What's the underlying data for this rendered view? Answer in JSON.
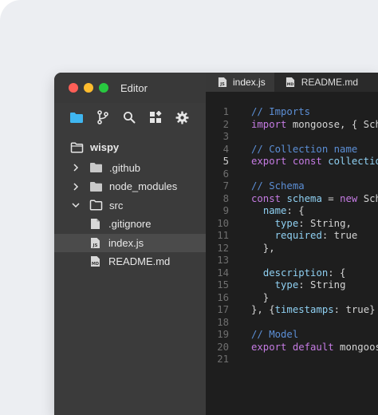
{
  "window": {
    "title": "Editor"
  },
  "activity_bar": [
    {
      "name": "explorer-icon",
      "active": true
    },
    {
      "name": "source-control-icon",
      "active": false
    },
    {
      "name": "search-icon",
      "active": false
    },
    {
      "name": "extensions-icon",
      "active": false
    },
    {
      "name": "settings-icon",
      "active": false
    }
  ],
  "explorer": {
    "root": "wispy",
    "items": [
      {
        "label": ".github",
        "type": "folder",
        "expanded": false
      },
      {
        "label": "node_modules",
        "type": "folder",
        "expanded": false
      },
      {
        "label": "src",
        "type": "folder",
        "expanded": true
      },
      {
        "label": ".gitignore",
        "type": "file",
        "badge": ""
      },
      {
        "label": "index.js",
        "type": "file",
        "badge": "JS",
        "selected": true
      },
      {
        "label": "README.md",
        "type": "file",
        "badge": "MD"
      }
    ]
  },
  "tabs": [
    {
      "label": "index.js",
      "badge": "JS",
      "active": true
    },
    {
      "label": "README.md",
      "badge": "MD",
      "active": false
    },
    {
      "label": "",
      "badge": "",
      "active": false
    }
  ],
  "code": {
    "current_line": 5,
    "lines": [
      {
        "n": "1",
        "tokens": [
          [
            "c",
            "// Imports"
          ]
        ]
      },
      {
        "n": "2",
        "tokens": [
          [
            "k",
            "import"
          ],
          [
            "p",
            " mongoose, { Sch"
          ]
        ]
      },
      {
        "n": "3",
        "tokens": []
      },
      {
        "n": "4",
        "tokens": [
          [
            "c",
            "// Collection name"
          ]
        ]
      },
      {
        "n": "5",
        "tokens": [
          [
            "k",
            "export const"
          ],
          [
            "p",
            " "
          ],
          [
            "v",
            "collectio"
          ]
        ]
      },
      {
        "n": "6",
        "tokens": []
      },
      {
        "n": "7",
        "tokens": [
          [
            "c",
            "// Schema"
          ]
        ]
      },
      {
        "n": "8",
        "tokens": [
          [
            "k",
            "const"
          ],
          [
            "p",
            " "
          ],
          [
            "v",
            "schema"
          ],
          [
            "p",
            " = "
          ],
          [
            "k",
            "new"
          ],
          [
            "p",
            " Sch"
          ]
        ]
      },
      {
        "n": "9",
        "tokens": [
          [
            "p",
            "  "
          ],
          [
            "v",
            "name"
          ],
          [
            "p",
            ": {"
          ]
        ]
      },
      {
        "n": "10",
        "tokens": [
          [
            "p",
            "    "
          ],
          [
            "v",
            "type"
          ],
          [
            "p",
            ": String,"
          ]
        ]
      },
      {
        "n": "11",
        "tokens": [
          [
            "p",
            "    "
          ],
          [
            "v",
            "required"
          ],
          [
            "p",
            ": true"
          ]
        ]
      },
      {
        "n": "12",
        "tokens": [
          [
            "p",
            "  },"
          ]
        ]
      },
      {
        "n": "13",
        "tokens": []
      },
      {
        "n": "14",
        "tokens": [
          [
            "p",
            "  "
          ],
          [
            "v",
            "description"
          ],
          [
            "p",
            ": {"
          ]
        ]
      },
      {
        "n": "15",
        "tokens": [
          [
            "p",
            "    "
          ],
          [
            "v",
            "type"
          ],
          [
            "p",
            ": String"
          ]
        ]
      },
      {
        "n": "16",
        "tokens": [
          [
            "p",
            "  }"
          ]
        ]
      },
      {
        "n": "17",
        "tokens": [
          [
            "p",
            "}, {"
          ],
          [
            "v",
            "timestamps"
          ],
          [
            "p",
            ": true}"
          ]
        ]
      },
      {
        "n": "18",
        "tokens": []
      },
      {
        "n": "19",
        "tokens": [
          [
            "c",
            "// Model"
          ]
        ]
      },
      {
        "n": "20",
        "tokens": [
          [
            "k",
            "export default"
          ],
          [
            "p",
            " mongoos"
          ]
        ]
      },
      {
        "n": "21",
        "tokens": []
      }
    ]
  },
  "colors": {
    "comment": "#5c8fd6",
    "keyword": "#c57be3",
    "identifier": "#8fd0f2",
    "folder_active": "#3fb6f0"
  }
}
